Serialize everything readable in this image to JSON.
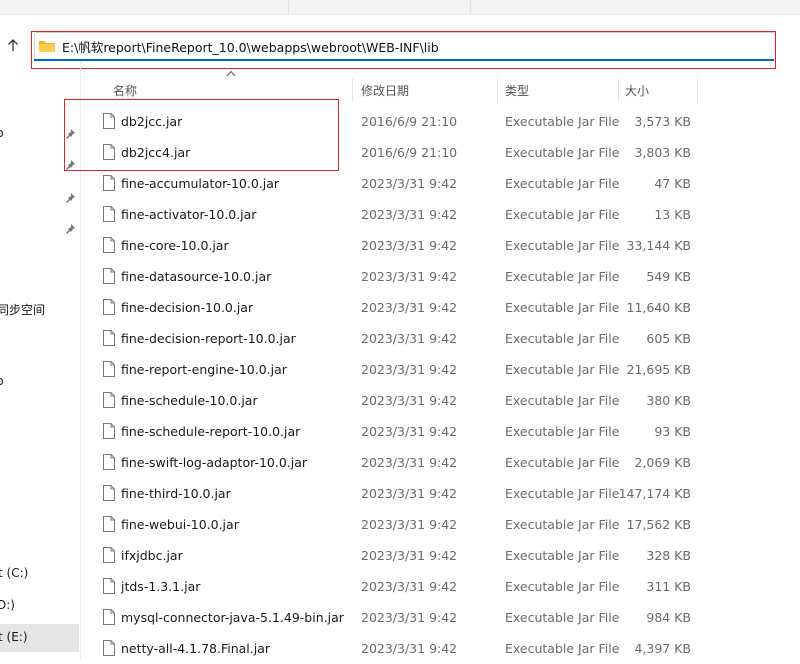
{
  "address": {
    "path": "E:\\帆软report\\FineReport_10.0\\webapps\\webroot\\WEB-INF\\lib"
  },
  "columns": {
    "name": "名称",
    "modified": "修改日期",
    "type": "类型",
    "size": "大小"
  },
  "sidebar": {
    "items": [
      {
        "label": "p"
      },
      {
        "label": "同步空间"
      },
      {
        "label": "p"
      },
      {
        "label": "t (C:)"
      },
      {
        "label": "D:)"
      },
      {
        "label": "t (E:)"
      }
    ]
  },
  "files": [
    {
      "name": "db2jcc.jar",
      "modified": "2016/6/9 21:10",
      "type": "Executable Jar File",
      "size": "3,573 KB"
    },
    {
      "name": "db2jcc4.jar",
      "modified": "2016/6/9 21:10",
      "type": "Executable Jar File",
      "size": "3,803 KB"
    },
    {
      "name": "fine-accumulator-10.0.jar",
      "modified": "2023/3/31 9:42",
      "type": "Executable Jar File",
      "size": "47 KB"
    },
    {
      "name": "fine-activator-10.0.jar",
      "modified": "2023/3/31 9:42",
      "type": "Executable Jar File",
      "size": "13 KB"
    },
    {
      "name": "fine-core-10.0.jar",
      "modified": "2023/3/31 9:42",
      "type": "Executable Jar File",
      "size": "33,144 KB"
    },
    {
      "name": "fine-datasource-10.0.jar",
      "modified": "2023/3/31 9:42",
      "type": "Executable Jar File",
      "size": "549 KB"
    },
    {
      "name": "fine-decision-10.0.jar",
      "modified": "2023/3/31 9:42",
      "type": "Executable Jar File",
      "size": "11,640 KB"
    },
    {
      "name": "fine-decision-report-10.0.jar",
      "modified": "2023/3/31 9:42",
      "type": "Executable Jar File",
      "size": "605 KB"
    },
    {
      "name": "fine-report-engine-10.0.jar",
      "modified": "2023/3/31 9:42",
      "type": "Executable Jar File",
      "size": "21,695 KB"
    },
    {
      "name": "fine-schedule-10.0.jar",
      "modified": "2023/3/31 9:42",
      "type": "Executable Jar File",
      "size": "380 KB"
    },
    {
      "name": "fine-schedule-report-10.0.jar",
      "modified": "2023/3/31 9:42",
      "type": "Executable Jar File",
      "size": "93 KB"
    },
    {
      "name": "fine-swift-log-adaptor-10.0.jar",
      "modified": "2023/3/31 9:42",
      "type": "Executable Jar File",
      "size": "2,069 KB"
    },
    {
      "name": "fine-third-10.0.jar",
      "modified": "2023/3/31 9:42",
      "type": "Executable Jar File",
      "size": "147,174 KB"
    },
    {
      "name": "fine-webui-10.0.jar",
      "modified": "2023/3/31 9:42",
      "type": "Executable Jar File",
      "size": "17,562 KB"
    },
    {
      "name": "ifxjdbc.jar",
      "modified": "2023/3/31 9:42",
      "type": "Executable Jar File",
      "size": "328 KB"
    },
    {
      "name": "jtds-1.3.1.jar",
      "modified": "2023/3/31 9:42",
      "type": "Executable Jar File",
      "size": "311 KB"
    },
    {
      "name": "mysql-connector-java-5.1.49-bin.jar",
      "modified": "2023/3/31 9:42",
      "type": "Executable Jar File",
      "size": "984 KB"
    },
    {
      "name": "netty-all-4.1.78.Final.jar",
      "modified": "2023/3/31 9:42",
      "type": "Executable Jar File",
      "size": "4,397 KB"
    }
  ],
  "colors": {
    "highlight": "#d9252a",
    "accent": "#0067c0",
    "folder": "#f0b429"
  }
}
